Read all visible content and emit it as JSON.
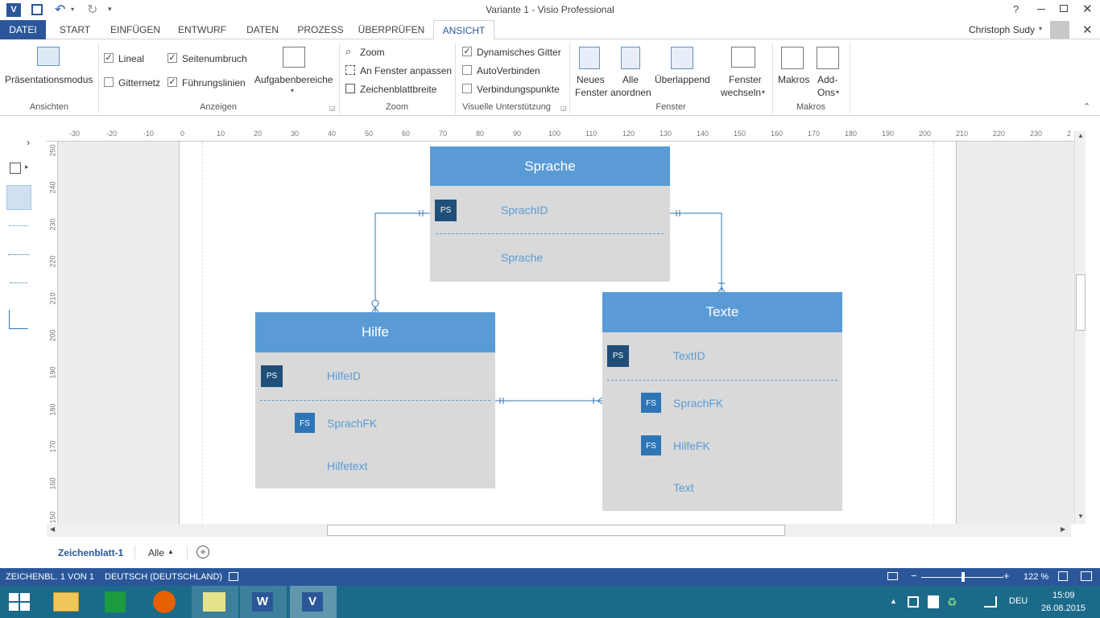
{
  "window": {
    "title": "Variante 1 - Visio Professional",
    "user": "Christoph Sudy",
    "help": "?"
  },
  "tabs": [
    "DATEI",
    "START",
    "EINFÜGEN",
    "ENTWURF",
    "DATEN",
    "PROZESS",
    "ÜBERPRÜFEN",
    "ANSICHT"
  ],
  "ribbon": {
    "ansichten": {
      "button": "Präsentationsmodus",
      "label": "Ansichten"
    },
    "anzeigen": {
      "label": "Anzeigen",
      "lineal": "Lineal",
      "seitenumbruch": "Seitenumbruch",
      "gitternetz": "Gitternetz",
      "fuehrungslinien": "Führungslinien",
      "aufgabenbereiche": "Aufgabenbereiche",
      "checks": {
        "lineal": "✓",
        "seitenumbruch": "✓",
        "gitternetz": "",
        "fuehrungslinien": "✓"
      }
    },
    "zoom": {
      "label": "Zoom",
      "zoom": "Zoom",
      "fit": "An Fenster anpassen",
      "width": "Zeichenblattbreite"
    },
    "visual": {
      "label": "Visuelle Unterstützung",
      "grid": "Dynamisches Gitter",
      "autoconnect": "AutoVerbinden",
      "points": "Verbindungspunkte",
      "checks": {
        "grid": "✓",
        "autoconnect": "",
        "points": ""
      }
    },
    "fenster": {
      "label": "Fenster",
      "new1": "Neues",
      "new2": "Fenster",
      "arrange1": "Alle",
      "arrange2": "anordnen",
      "cascade": "Überlappend",
      "switch1": "Fenster",
      "switch2": "wechseln"
    },
    "makros": {
      "label": "Makros",
      "macros": "Makros",
      "addons1": "Add-",
      "addons2": "Ons"
    }
  },
  "ruler_top": [
    "-30",
    "-20",
    "-10",
    "0",
    "10",
    "20",
    "30",
    "40",
    "50",
    "60",
    "70",
    "80",
    "90",
    "100",
    "110",
    "120",
    "130",
    "140",
    "150",
    "160",
    "170",
    "180",
    "190",
    "200",
    "210",
    "220",
    "230",
    "2"
  ],
  "ruler_left": [
    "250",
    "240",
    "230",
    "220",
    "210",
    "200",
    "190",
    "180",
    "170",
    "160",
    "150"
  ],
  "entities": {
    "sprache": {
      "title": "Sprache",
      "pk_badge": "PS",
      "pk": "SprachID",
      "attr": "Sprache"
    },
    "hilfe": {
      "title": "Hilfe",
      "pk_badge": "PS",
      "pk": "HilfeID",
      "fk_badge": "FS",
      "fk": "SprachFK",
      "attr": "Hilfetext"
    },
    "texte": {
      "title": "Texte",
      "pk_badge": "PS",
      "pk": "TextID",
      "fk1_badge": "FS",
      "fk1": "SprachFK",
      "fk2_badge": "FS",
      "fk2": "HilfeFK",
      "attr": "Text"
    }
  },
  "sheets": {
    "active": "Zeichenblatt-1",
    "all": "Alle"
  },
  "status": {
    "page": "ZEICHENBL. 1 VON 1",
    "language": "DEUTSCH (DEUTSCHLAND)",
    "zoom": "122 %"
  },
  "taskbar": {
    "lang": "DEU",
    "time": "15:09",
    "date": "26.08.2015"
  },
  "colors": {
    "accent": "#2b579a",
    "entity_head": "#5b9bd5",
    "entity_body": "#d9d9d9",
    "pk_badge": "#1f4e79",
    "fk_badge": "#2e75b6"
  }
}
